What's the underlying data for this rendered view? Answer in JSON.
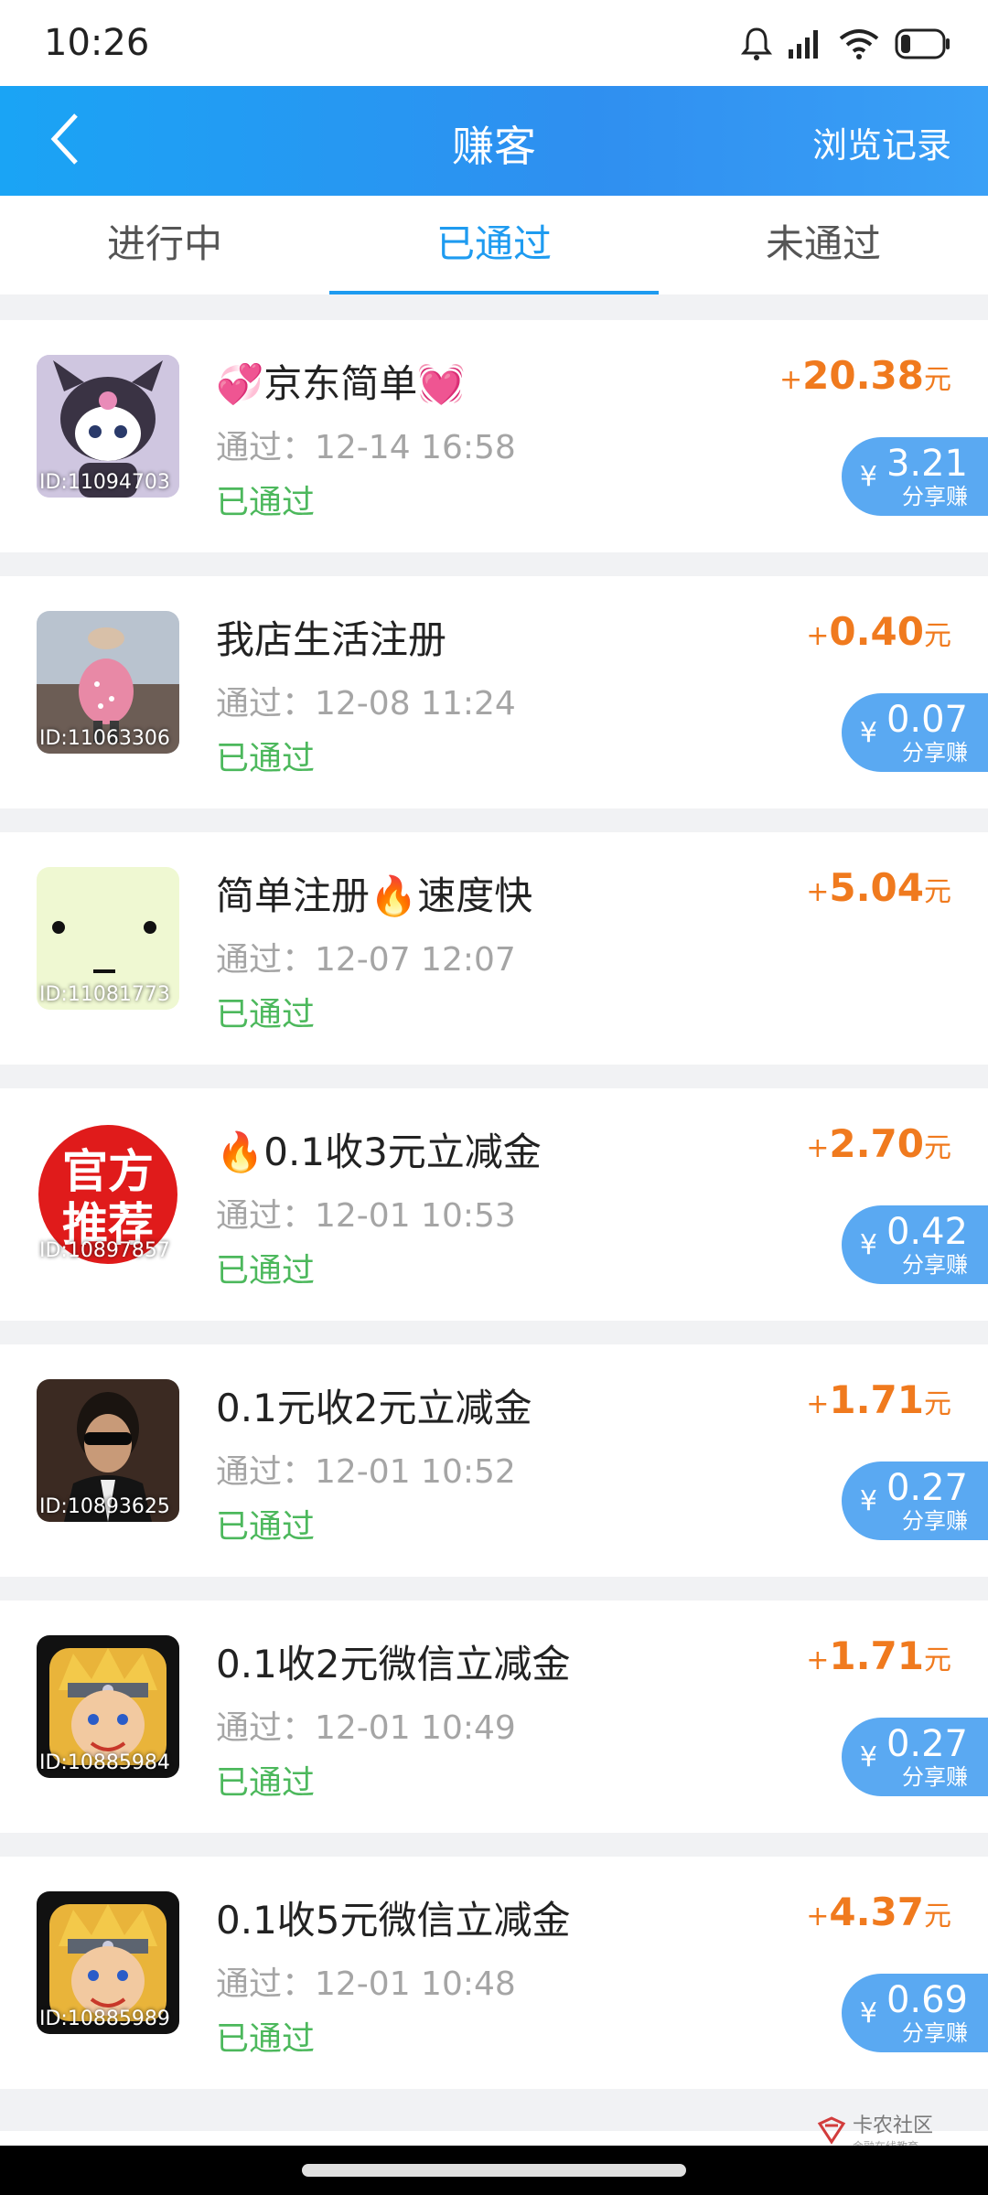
{
  "status_bar": {
    "time": "10:26"
  },
  "app_bar": {
    "title": "赚客",
    "history_label": "浏览记录"
  },
  "tabs": [
    {
      "label": "进行中",
      "active": false
    },
    {
      "label": "已通过",
      "active": true
    },
    {
      "label": "未通过",
      "active": false
    }
  ],
  "items": [
    {
      "title": "💞京东简单💓",
      "time": "通过：12-14 16:58",
      "status": "已通过",
      "id": "ID:11094703",
      "reward_plus": "+",
      "reward": "20.38",
      "unit": "元",
      "share_yen": "¥",
      "share_amount": "3.21",
      "share_label": "分享赚",
      "thumb_color": "#d9d1e8"
    },
    {
      "title": "我店生活注册",
      "time": "通过：12-08 11:24",
      "status": "已通过",
      "id": "ID:11063306",
      "reward_plus": "+",
      "reward": "0.40",
      "unit": "元",
      "share_yen": "¥",
      "share_amount": "0.07",
      "share_label": "分享赚",
      "thumb_color": "#9a8f8a"
    },
    {
      "title": "简单注册🔥速度快",
      "time": "通过：12-07 12:07",
      "status": "已通过",
      "id": "ID:11081773",
      "reward_plus": "+",
      "reward": "5.04",
      "unit": "元",
      "thumb_color": "#eef8d0"
    },
    {
      "title": "🔥0.1收3元立减金",
      "time": "通过：12-01 10:53",
      "status": "已通过",
      "id": "ID:10897857",
      "reward_plus": "+",
      "reward": "2.70",
      "unit": "元",
      "share_yen": "¥",
      "share_amount": "0.42",
      "share_label": "分享赚",
      "thumb_color": "#ffffff",
      "thumb_badge_line1": "官方",
      "thumb_badge_line2": "推荐"
    },
    {
      "title": "0.1元收2元立减金",
      "time": "通过：12-01 10:52",
      "status": "已通过",
      "id": "ID:10893625",
      "reward_plus": "+",
      "reward": "1.71",
      "unit": "元",
      "share_yen": "¥",
      "share_amount": "0.27",
      "share_label": "分享赚",
      "thumb_color": "#3b2a22"
    },
    {
      "title": "0.1收2元微信立减金",
      "time": "通过：12-01 10:49",
      "status": "已通过",
      "id": "ID:10885984",
      "reward_plus": "+",
      "reward": "1.71",
      "unit": "元",
      "share_yen": "¥",
      "share_amount": "0.27",
      "share_label": "分享赚",
      "thumb_color": "#e9b43a"
    },
    {
      "title": "0.1收5元微信立减金",
      "time": "通过：12-01 10:48",
      "status": "已通过",
      "id": "ID:10885989",
      "reward_plus": "+",
      "reward": "4.37",
      "unit": "元",
      "share_yen": "¥",
      "share_amount": "0.69",
      "share_label": "分享赚",
      "thumb_color": "#e9b43a"
    }
  ],
  "watermark": {
    "main": "卡农社区",
    "sub": "金融在线教育"
  },
  "colors": {
    "accent": "#1e9bf0",
    "reward": "#f07a1e",
    "status_ok": "#4cb85c",
    "share_badge": "#5aa9f2"
  }
}
